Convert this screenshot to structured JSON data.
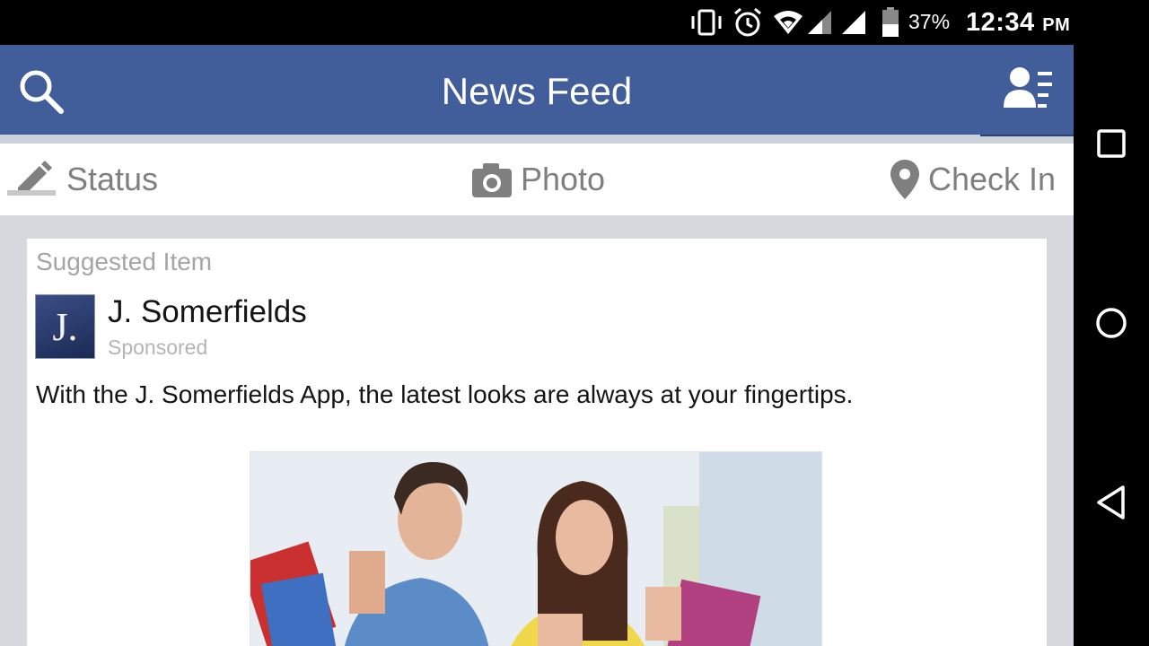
{
  "status_bar": {
    "battery_percent": "37%",
    "time": "12:34",
    "am_pm": "PM",
    "icons": [
      "vibrate-icon",
      "alarm-icon",
      "wifi-icon",
      "signal-icon",
      "signal-icon",
      "battery-icon"
    ]
  },
  "header": {
    "title": "News Feed",
    "left_icon": "search-icon",
    "right_icon": "friend-requests-icon",
    "bar_color": "#415e9b"
  },
  "composer": {
    "status_label": "Status",
    "photo_label": "Photo",
    "checkin_label": "Check In"
  },
  "post": {
    "suggested_label": "Suggested Item",
    "avatar_letter": "J.",
    "page_name": "J. Somerfields",
    "sponsored_label": "Sponsored",
    "body": "With the J. Somerfields App, the latest looks are always at your fingertips.",
    "image": "shopping-couple-photo"
  },
  "nav_bar": {
    "buttons": [
      "recents-button",
      "home-button",
      "back-button"
    ]
  }
}
